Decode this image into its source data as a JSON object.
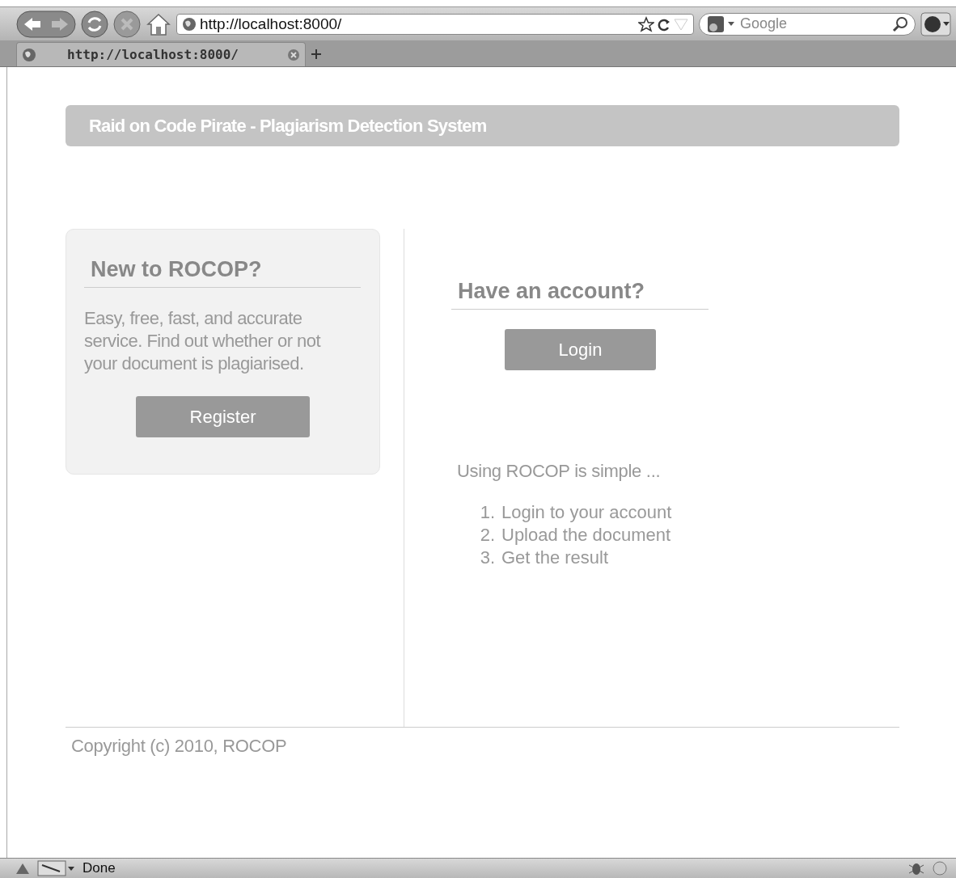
{
  "browser": {
    "address": "http://localhost:8000/",
    "search_placeholder": "Google",
    "tabs": [
      {
        "label": "http://localhost:8000/",
        "selected": true
      }
    ],
    "status": "Done"
  },
  "header": {
    "title": "Raid on Code Pirate - Plagiarism Detection System"
  },
  "register_panel": {
    "heading": "New to ROCOP?",
    "text": "Easy, free, fast, and accurate service. Find out whether or not your document is plagiarised.",
    "button": "Register"
  },
  "login_panel": {
    "heading": "Have an account?",
    "button": "Login",
    "intro": "Using ROCOP is simple ...",
    "steps": [
      {
        "number": "1.",
        "text": "Login to your account"
      },
      {
        "number": "2.",
        "text": "Upload the document"
      },
      {
        "number": "3.",
        "text": "Get the result"
      }
    ]
  },
  "footer": {
    "text": "Copyright (c) 2010, ROCOP"
  }
}
